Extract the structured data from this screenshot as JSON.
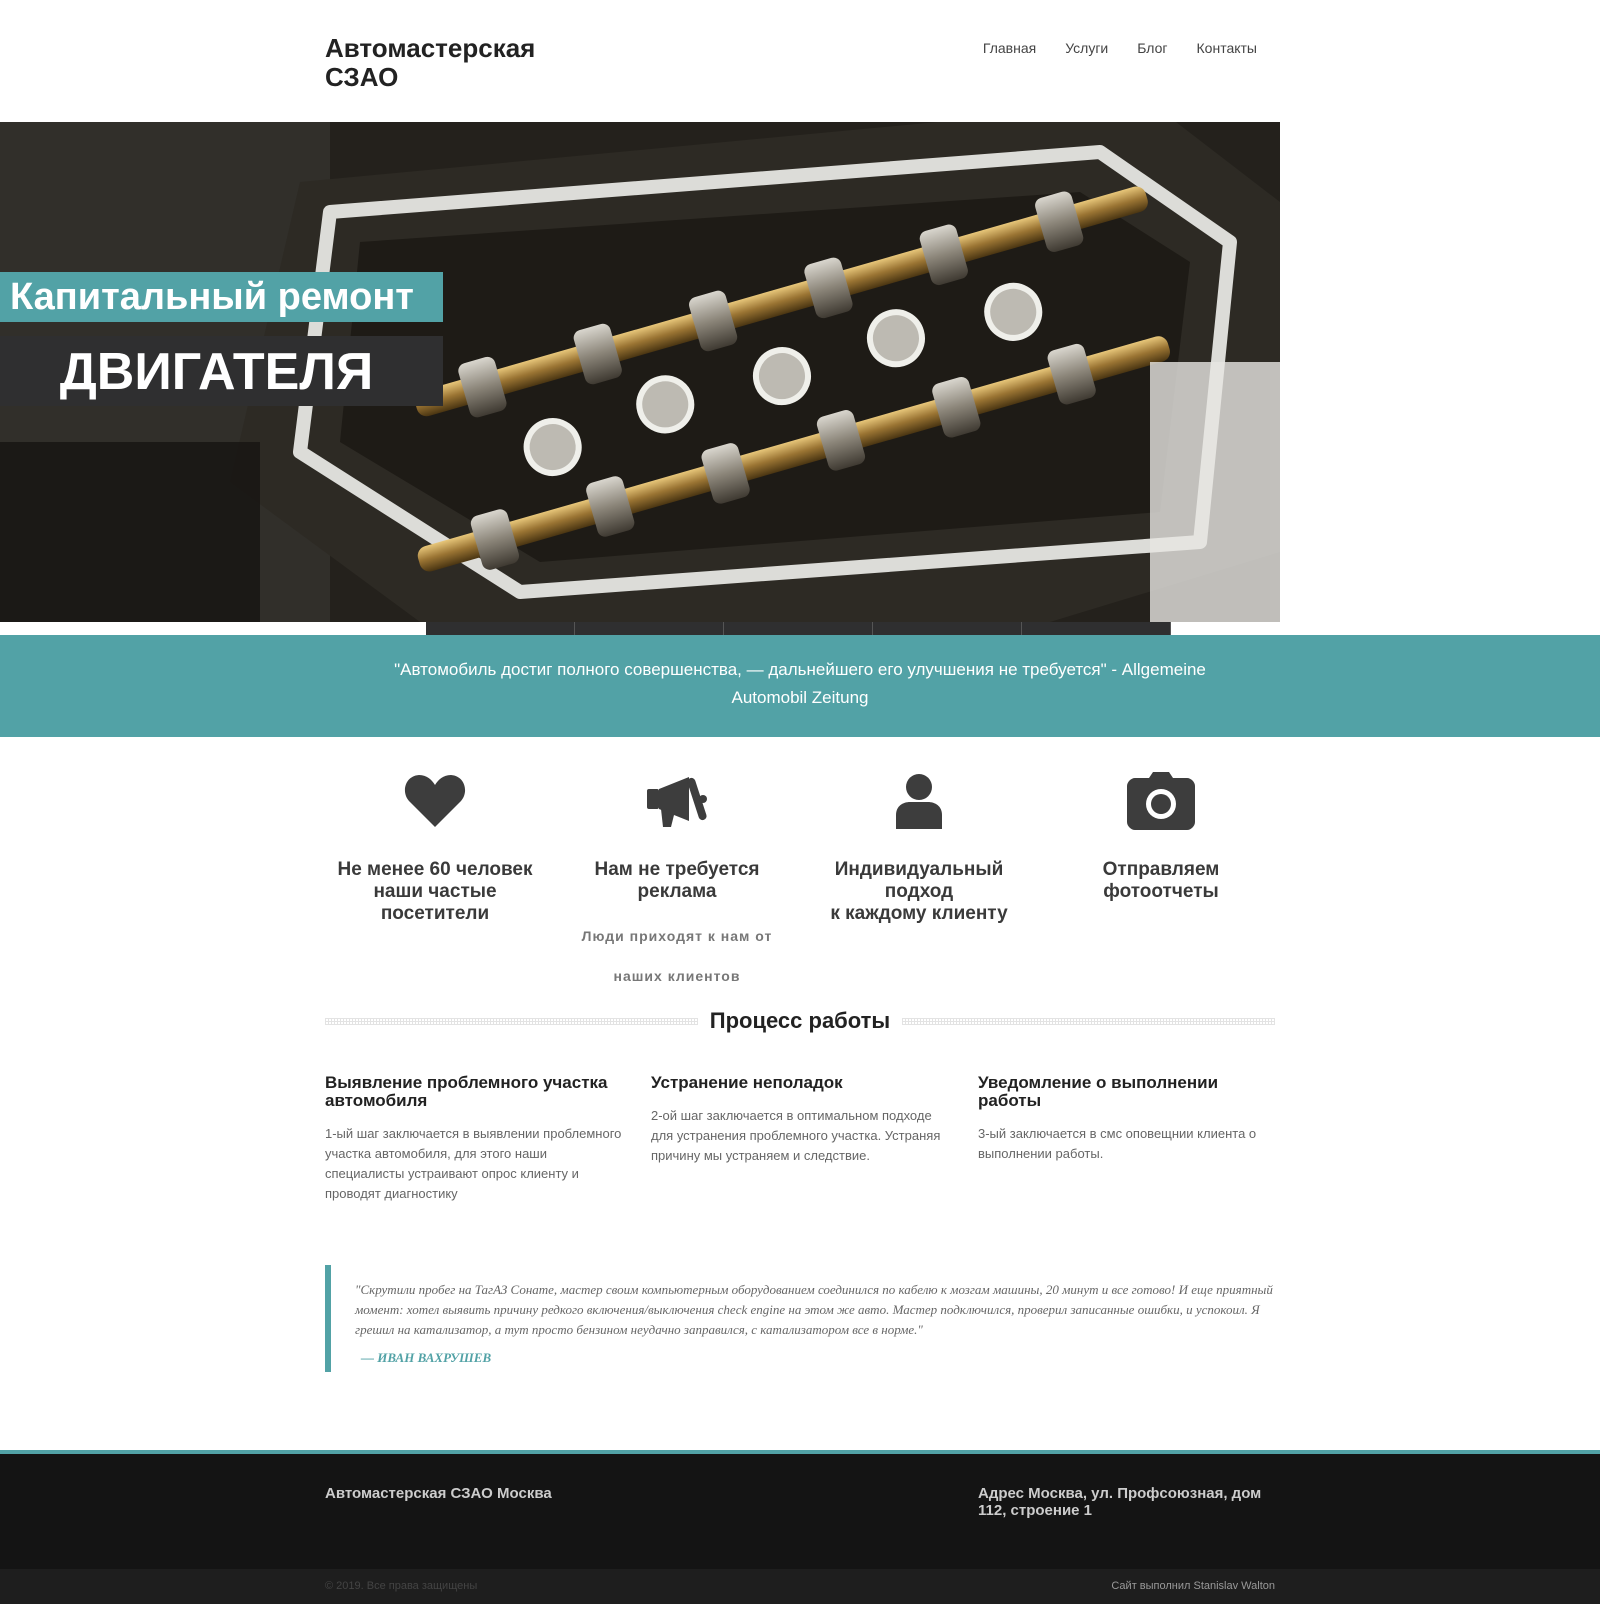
{
  "header": {
    "brand": "Автомастерская СЗАО",
    "nav": [
      "Главная",
      "Услуги",
      "Блог",
      "Контакты"
    ]
  },
  "hero": {
    "title_line1": "Капитальный ремонт",
    "title_line2": "ДВИГАТЕЛЯ",
    "slide_count": 5,
    "colors": {
      "accent": "#52a2a6",
      "dark": "#2f2f30"
    }
  },
  "quote": {
    "text": "\"Автомобиль достиг полного совершенства, — дальнейшего его улучшения не требуется\" - Allgemeine Automobil Zeitung"
  },
  "features": [
    {
      "icon": "heart-icon",
      "title": "Не менее 60 человек\nнаши частые\nпосетители",
      "desc": ""
    },
    {
      "icon": "megaphone-icon",
      "title": "Нам не требуется\nреклама",
      "desc": "Люди приходят к нам от наших клиентов"
    },
    {
      "icon": "user-icon",
      "title": "Индивидуальный\nподход\nк каждому клиенту",
      "desc": ""
    },
    {
      "icon": "camera-icon",
      "title": "Отправляем\nфотоотчеты",
      "desc": ""
    }
  ],
  "process": {
    "title": "Процесс работы",
    "steps": [
      {
        "title": "Выявление проблемного участка автомобиля",
        "text": "1-ый шаг заключается в выявлении проблемного участка автомобиля, для этого наши специалисты устраивают опрос клиенту и проводят диагностику"
      },
      {
        "title": "Устранение неполадок",
        "text": "2-ой шаг заключается в оптимальном подходе для устранения проблемного участка. Устраняя причину мы устраняем и следствие."
      },
      {
        "title": "Уведомление о выполнении работы",
        "text": "3-ый заключается в смс оповещнии клиента о выполнении работы."
      }
    ]
  },
  "testimonial": {
    "text": "\"Скрутили пробег на ТагАЗ Сонате, мастер своим компьютерным оборудованием соединился по кабелю к мозгам машины, 20 минут и все готово! И еще приятный момент: хотел выявить причину редкого включения/выключения check engine на этом же авто. Мастер подключился, проверил записанные ошибки, и успокоил. Я грешил на катализатор, а тут просто бензином неудачно заправился, с катализатором все в норме.\"",
    "author": "— ИВАН ВАХРУШЕВ"
  },
  "footer": {
    "left": "Автомастерская СЗАО Москва",
    "right": "Адрес Москва, ул. Профсоюзная, дом 112, строение 1",
    "copyright": "© 2019. Все права защищены",
    "credit": "Сайт выполнил Stanislav Walton"
  }
}
